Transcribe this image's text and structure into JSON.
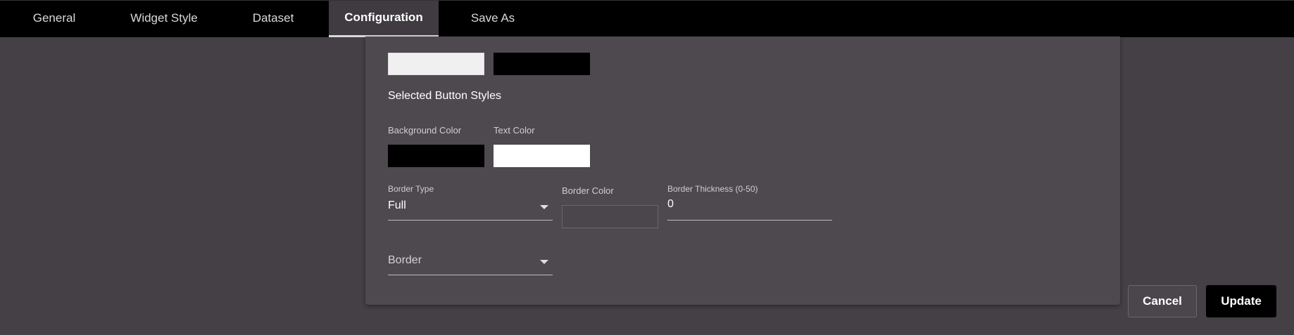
{
  "tabs": [
    {
      "label": "General"
    },
    {
      "label": "Widget Style"
    },
    {
      "label": "Dataset"
    },
    {
      "label": "Configuration"
    },
    {
      "label": "Save As"
    }
  ],
  "active_tab": "Configuration",
  "colors": {
    "unselected_background_swatch": "#f0f0f0",
    "unselected_text_swatch": "#000000",
    "selected_background_swatch": "#000000",
    "selected_text_swatch": "#ffffff",
    "border_color_swatch": "#4a464b"
  },
  "selected_styles": {
    "title": "Selected Button Styles",
    "background_color_label": "Background Color",
    "text_color_label": "Text Color"
  },
  "border": {
    "type_label": "Border Type",
    "type_value": "Full",
    "color_label": "Border Color",
    "thickness_label": "Border Thickness (0-50)",
    "thickness_value": "0",
    "border_select_placeholder": "Border"
  },
  "actions": {
    "cancel_label": "Cancel",
    "update_label": "Update"
  }
}
